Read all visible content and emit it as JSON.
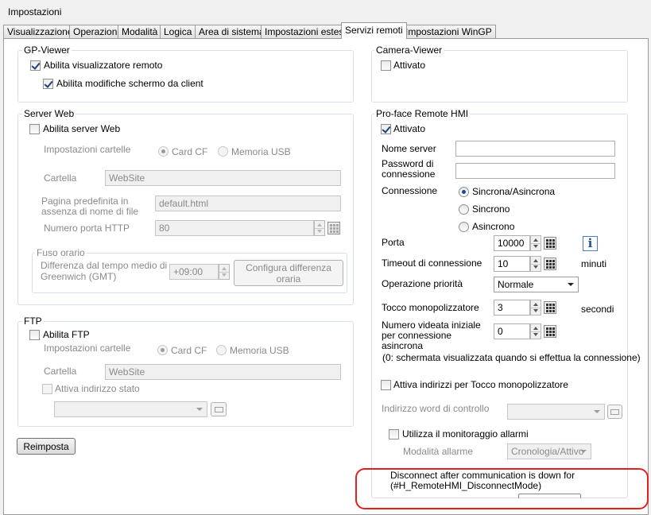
{
  "window": {
    "title": "Impostazioni"
  },
  "tabs": [
    "Visualizzazione",
    "Operazioni",
    "Modalità",
    "Logica",
    "Area di sistema",
    "Impostazioni estese",
    "Servizi remoti",
    "Impostazioni WinGP"
  ],
  "active_tab": "Servizi remoti",
  "gp_viewer": {
    "title": "GP-Viewer",
    "enable_remote_viewer": {
      "label": "Abilita visualizzatore remoto",
      "checked": true
    },
    "enable_client_edit": {
      "label": "Abilita modifiche schermo da client",
      "checked": true
    }
  },
  "camera_viewer": {
    "title": "Camera-Viewer",
    "activated": {
      "label": "Attivato",
      "checked": false
    }
  },
  "server_web": {
    "title": "Server Web",
    "enable": {
      "label": "Abilita server Web",
      "checked": false
    },
    "folder_settings_label": "Impostazioni cartelle",
    "radio_card_cf": "Card CF",
    "radio_usb": "Memoria USB",
    "folder_label": "Cartella",
    "folder_value": "WebSite",
    "default_page_label": "Pagina predefinita in assenza di nome di file",
    "default_page_value": "default.html",
    "http_port_label": "Numero porta HTTP",
    "http_port_value": "80",
    "timezone": {
      "title": "Fuso orario",
      "gmt_label": "Differenza dal tempo medio di Greenwich (GMT)",
      "gmt_value": "+09:00",
      "configure_button": "Configura differenza oraria"
    }
  },
  "ftp": {
    "title": "FTP",
    "enable": {
      "label": "Abilita FTP",
      "checked": false
    },
    "folder_settings_label": "Impostazioni cartelle",
    "radio_card_cf": "Card CF",
    "radio_usb": "Memoria USB",
    "folder_label": "Cartella",
    "folder_value": "WebSite",
    "status_address": {
      "label": "Attiva indirizzo stato",
      "checked": false
    },
    "address_value": ""
  },
  "reset_button": "Reimposta",
  "remote_hmi": {
    "title": "Pro-face Remote HMI",
    "activated": {
      "label": "Attivato",
      "checked": true
    },
    "server_name_label": "Nome server",
    "server_name_value": "",
    "password_label": "Password di connessione",
    "password_value": "",
    "connection_label": "Connessione",
    "connection_options": [
      "Sincrona/Asincrona",
      "Sincrono",
      "Asincrono"
    ],
    "connection_selected": "Sincrona/Asincrona",
    "port_label": "Porta",
    "port_value": "10000",
    "timeout_label": "Timeout di connessione",
    "timeout_value": "10",
    "timeout_unit": "minuti",
    "priority_label": "Operazione priorità",
    "priority_value": "Normale",
    "touch_label": "Tocco monopolizzatore",
    "touch_value": "3",
    "touch_unit": "secondi",
    "initial_screen_label": "Numero videata iniziale per connessione asincrona",
    "initial_screen_value": "0",
    "initial_screen_note": "(0: schermata visualizzata quando si effettua la connessione)",
    "touch_address": {
      "label": "Attiva indirizzi per Tocco monopolizzatore",
      "checked": false
    },
    "control_word_label": "Indirizzo word di controllo",
    "control_word_value": "",
    "alarm_monitoring": {
      "label": "Utilizza il monitoraggio allarmi",
      "checked": false
    },
    "alarm_mode_label": "Modalità allarme",
    "alarm_mode_value": "Cronologia/Attivo",
    "disconnect_text": "Disconnect after communication is down for (#H_RemoteHMI_DisconnectMode)"
  },
  "colors": {
    "highlight": "#e32020",
    "accent": "#1e4a8c"
  },
  "icons": [
    "checkbox-check-icon",
    "radio-dot-icon",
    "spin-arrows-icon",
    "keypad-icon",
    "info-icon",
    "dropdown-arrow-icon"
  ]
}
